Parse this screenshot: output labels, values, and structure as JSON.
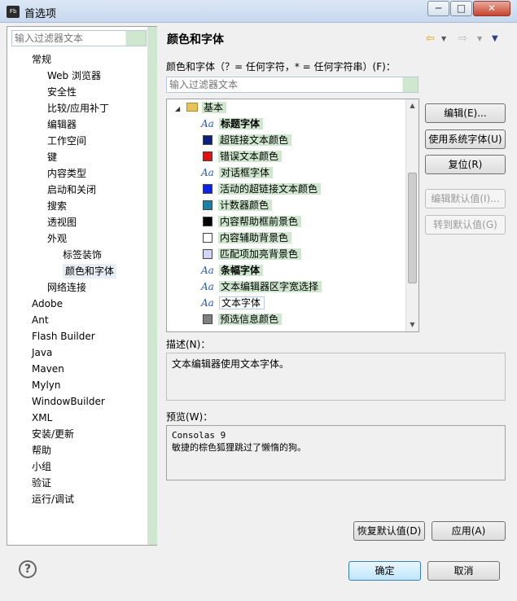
{
  "window": {
    "app_icon": "Fb",
    "title": "首选项",
    "controls": {
      "minimize": "─",
      "maximize": "□",
      "close": "✕"
    }
  },
  "left": {
    "filter_placeholder": "输入过滤器文本",
    "tree": [
      {
        "label": "常规",
        "level": 1
      },
      {
        "label": "Web 浏览器",
        "level": 2
      },
      {
        "label": "安全性",
        "level": 2
      },
      {
        "label": "比较/应用补丁",
        "level": 2
      },
      {
        "label": "编辑器",
        "level": 2
      },
      {
        "label": "工作空间",
        "level": 2
      },
      {
        "label": "键",
        "level": 2
      },
      {
        "label": "内容类型",
        "level": 2
      },
      {
        "label": "启动和关闭",
        "level": 2
      },
      {
        "label": "搜索",
        "level": 2
      },
      {
        "label": "透视图",
        "level": 2
      },
      {
        "label": "外观",
        "level": 2
      },
      {
        "label": "标签装饰",
        "level": 3
      },
      {
        "label": "颜色和字体",
        "level": 3,
        "selected": true
      },
      {
        "label": "网络连接",
        "level": 2
      },
      {
        "label": "Adobe",
        "level": 1
      },
      {
        "label": "Ant",
        "level": 1
      },
      {
        "label": "Flash Builder",
        "level": 1
      },
      {
        "label": "Java",
        "level": 1
      },
      {
        "label": "Maven",
        "level": 1
      },
      {
        "label": "Mylyn",
        "level": 1
      },
      {
        "label": "WindowBuilder",
        "level": 1
      },
      {
        "label": "XML",
        "level": 1
      },
      {
        "label": "安装/更新",
        "level": 1
      },
      {
        "label": "帮助",
        "level": 1
      },
      {
        "label": "小组",
        "level": 1
      },
      {
        "label": "验证",
        "level": 1
      },
      {
        "label": "运行/调试",
        "level": 1
      }
    ]
  },
  "right": {
    "title": "颜色和字体",
    "nav_icons": {
      "back": "⇦",
      "forward": "⇨",
      "menu": "▼"
    },
    "section_label": "颜色和字体（？= 任何字符，* = 任何字符串）(F)：",
    "filter_placeholder": "输入过滤器文本",
    "category": "基本",
    "items": [
      {
        "label": "标题字体",
        "kind": "font",
        "bold": true
      },
      {
        "label": "超链接文本颜色",
        "kind": "color",
        "color": "#0a1f7e"
      },
      {
        "label": "错误文本颜色",
        "kind": "color",
        "color": "#e01010"
      },
      {
        "label": "对话框字体",
        "kind": "font"
      },
      {
        "label": "活动的超链接文本颜色",
        "kind": "color",
        "color": "#0a22e8"
      },
      {
        "label": "计数器颜色",
        "kind": "color",
        "color": "#1a80a6"
      },
      {
        "label": "内容帮助框前景色",
        "kind": "color",
        "color": "#000000"
      },
      {
        "label": "内容辅助背景色",
        "kind": "color",
        "color": "#ffffff"
      },
      {
        "label": "匹配项加亮背景色",
        "kind": "color",
        "color": "#d4d4f4"
      },
      {
        "label": "条幅字体",
        "kind": "font",
        "bold": true
      },
      {
        "label": "文本编辑器区字宽选择",
        "kind": "font"
      },
      {
        "label": "文本字体",
        "kind": "font",
        "selected": true
      },
      {
        "label": "预选信息颜色",
        "kind": "color",
        "color": "#808080"
      }
    ],
    "buttons": {
      "edit": "编辑(E)...",
      "use_system_font": "使用系统字体(U)",
      "reset": "复位(R)",
      "edit_default": "编辑默认值(I)...",
      "goto_default": "转到默认值(G)"
    },
    "description_label": "描述(N)：",
    "description": "文本编辑器使用文本字体。",
    "preview_label": "预览(W)：",
    "preview_lines": [
      "Consolas 9",
      "敏捷的棕色狐狸跳过了懒惰的狗。"
    ],
    "restore_defaults": "恢复默认值(D)",
    "apply": "应用(A)"
  },
  "footer": {
    "help_icon": "?",
    "ok": "确定",
    "cancel": "取消"
  }
}
